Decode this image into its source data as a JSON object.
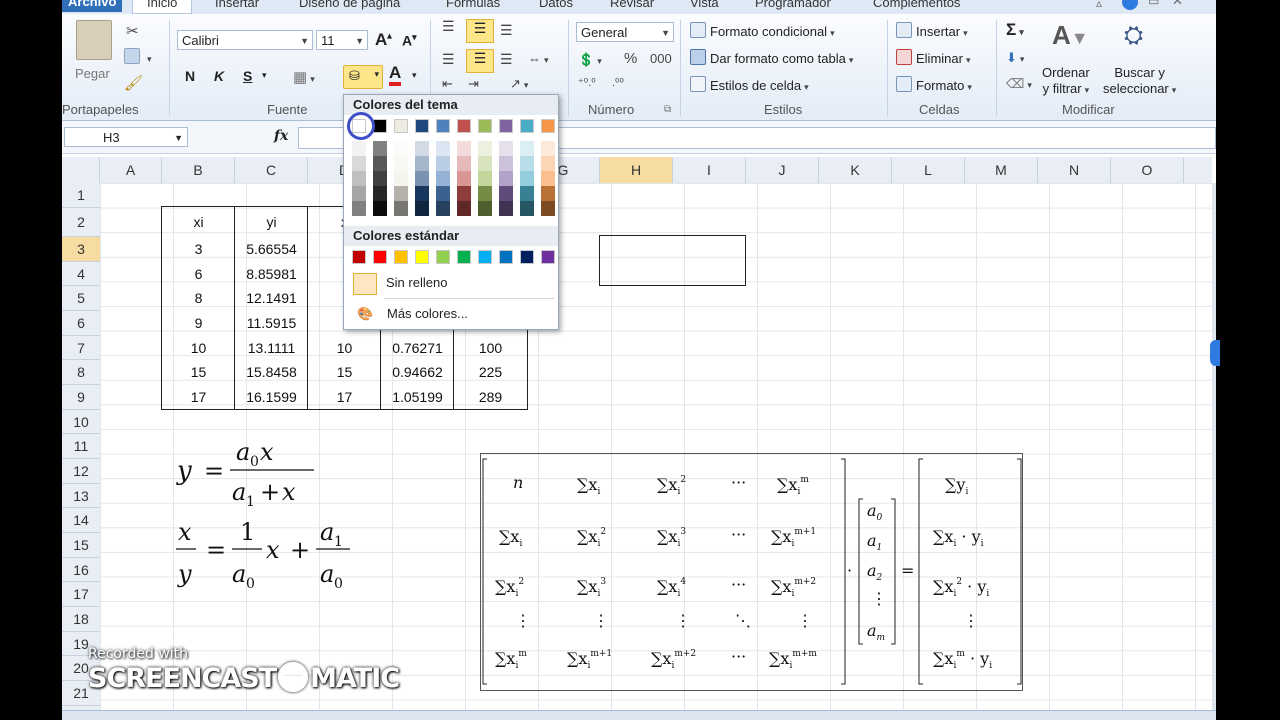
{
  "ribbon": {
    "tabs": [
      "Archivo",
      "Inicio",
      "Insertar",
      "Diseño de página",
      "Fórmulas",
      "Datos",
      "Revisar",
      "Vista",
      "Programador",
      "Complementos"
    ],
    "clipboard": {
      "paste": "Pegar",
      "label": "Portapapeles"
    },
    "font": {
      "name": "Calibri",
      "size": "11",
      "label": "Fuente",
      "bold": "N",
      "italic": "K",
      "underline": "S"
    },
    "number": {
      "format": "General",
      "label": "Número"
    },
    "styles": {
      "conditional": "Formato condicional",
      "table": "Dar formato como tabla",
      "cell": "Estilos de celda",
      "label": "Estilos"
    },
    "cells": {
      "insert": "Insertar",
      "delete": "Eliminar",
      "format": "Formato",
      "label": "Celdas"
    },
    "modify": {
      "sum": "Σ",
      "sort1": "Ordenar",
      "sort2": "y filtrar",
      "find1": "Buscar y",
      "find2": "seleccionar",
      "label": "Modificar"
    }
  },
  "formula_bar": {
    "name_box": "H3",
    "fx": "fx"
  },
  "columns": [
    "A",
    "B",
    "C",
    "D",
    "E",
    "F",
    "G",
    "H",
    "I",
    "J",
    "K",
    "L",
    "M",
    "N",
    "O"
  ],
  "rows": [
    "1",
    "2",
    "3",
    "4",
    "5",
    "6",
    "7",
    "8",
    "9",
    "10",
    "11",
    "12",
    "13",
    "14",
    "15",
    "16",
    "17",
    "18",
    "19",
    "20",
    "21"
  ],
  "table": {
    "headers": [
      "xi",
      "yi",
      "x"
    ],
    "col_b": [
      "3",
      "6",
      "8",
      "9",
      "10",
      "15",
      "17"
    ],
    "col_c": [
      "5.66554",
      "8.85981",
      "12.1491",
      "11.5915",
      "13.1111",
      "15.8458",
      "16.1599"
    ],
    "col_d": [
      "10",
      "15",
      "17"
    ],
    "col_e": [
      "0.76271",
      "0.94662",
      "1.05199"
    ],
    "col_f": [
      "100",
      "225",
      "289"
    ]
  },
  "popup": {
    "theme_title": "Colores del tema",
    "standard_title": "Colores estándar",
    "no_fill": "Sin relleno",
    "more_colors": "Más colores...",
    "theme_top": [
      "#ffffff",
      "#000000",
      "#eeece1",
      "#1f497d",
      "#4f81bd",
      "#c0504d",
      "#9bbb59",
      "#8064a2",
      "#4bacc6",
      "#f79646"
    ],
    "standard": [
      "#c00000",
      "#ff0000",
      "#ffc000",
      "#ffff00",
      "#92d050",
      "#00b050",
      "#00b0f0",
      "#0070c0",
      "#002060",
      "#7030a0"
    ]
  },
  "watermark": {
    "line1": "Recorded with",
    "line2": "SCREENCAST",
    "line3": "MATIC"
  }
}
